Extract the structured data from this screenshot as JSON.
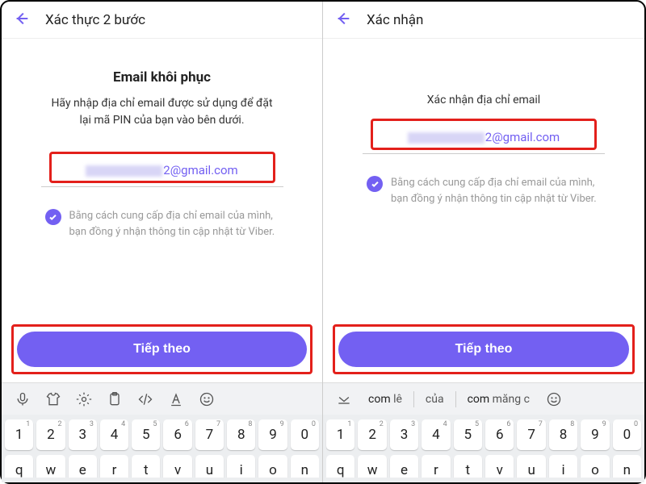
{
  "left": {
    "header_title": "Xác thực 2 bước",
    "heading": "Email khôi phục",
    "subtext": "Hãy nhập địa chỉ email được sử dụng để đặt lại mã PIN của bạn vào bên dưới.",
    "email_suffix": "2@gmail.com",
    "consent": "Bằng cách cung cấp địa chỉ email của mình, bạn đồng ý nhận thông tin cập nhật từ Viber.",
    "button": "Tiếp theo"
  },
  "right": {
    "header_title": "Xác nhận",
    "subtext": "Xác nhận địa chỉ email",
    "email_suffix": "2@gmail.com",
    "consent": "Bằng cách cung cấp địa chỉ email của mình, bạn đồng ý nhận thông tin cập nhật từ Viber.",
    "button": "Tiếp theo",
    "suggestions": {
      "w1a": "com",
      "w1b": " lê",
      "w2": "của",
      "w3a": "com",
      "w3b": " măng c"
    }
  },
  "keyboard": {
    "row1": [
      {
        "k": "1",
        "s": "1"
      },
      {
        "k": "2",
        "s": "2"
      },
      {
        "k": "3",
        "s": "3"
      },
      {
        "k": "4",
        "s": "4"
      },
      {
        "k": "5",
        "s": "5"
      },
      {
        "k": "6",
        "s": "6"
      },
      {
        "k": "7",
        "s": "7"
      },
      {
        "k": "8",
        "s": "8"
      },
      {
        "k": "9",
        "s": "9"
      },
      {
        "k": "0",
        "s": "0"
      }
    ],
    "row2": [
      "q",
      "w",
      "e",
      "r",
      "t",
      "v",
      "u",
      "i",
      "o",
      "n"
    ]
  }
}
